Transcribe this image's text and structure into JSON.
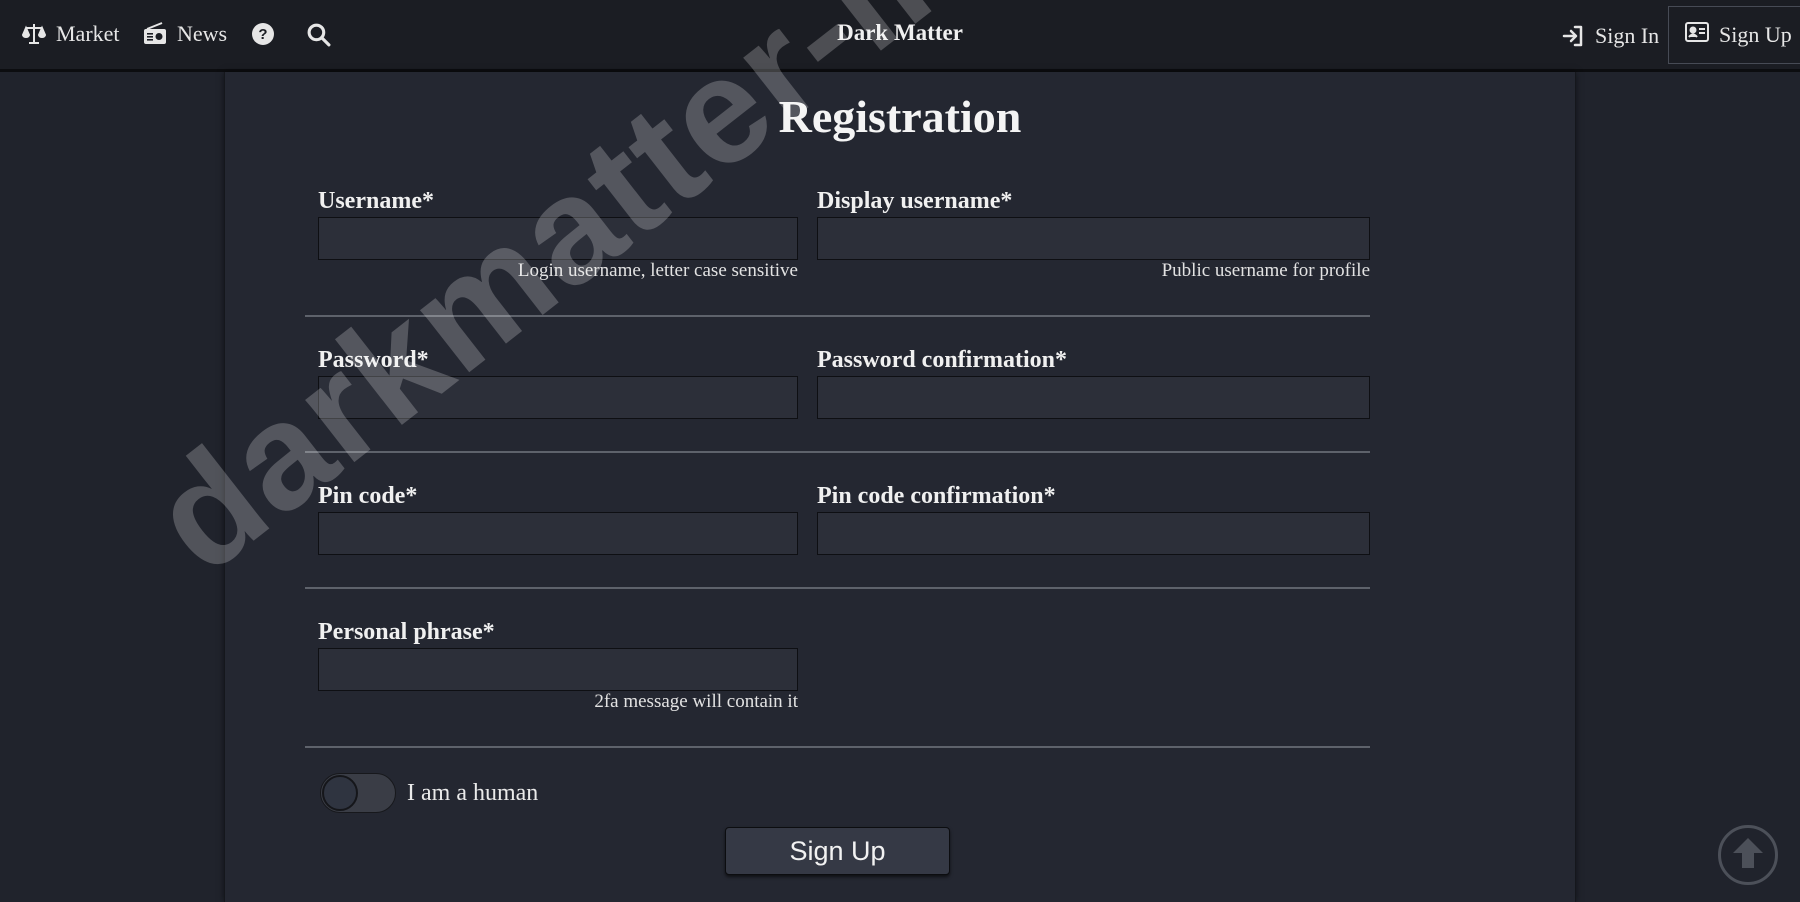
{
  "header": {
    "market_label": "Market",
    "news_label": "News",
    "site_title": "Dark Matter",
    "signin_label": "Sign In",
    "signup_label": "Sign Up"
  },
  "page": {
    "title": "Registration"
  },
  "form": {
    "username": {
      "label": "Username*",
      "value": "",
      "hint": "Login username, letter case sensitive"
    },
    "display_username": {
      "label": "Display username*",
      "value": "",
      "hint": "Public username for profile"
    },
    "password": {
      "label": "Password*",
      "value": ""
    },
    "password_confirmation": {
      "label": "Password confirmation*",
      "value": ""
    },
    "pin_code": {
      "label": "Pin code*",
      "value": ""
    },
    "pin_code_confirmation": {
      "label": "Pin code confirmation*",
      "value": ""
    },
    "personal_phrase": {
      "label": "Personal phrase*",
      "value": "",
      "hint": "2fa message will contain it"
    },
    "human_toggle": {
      "label": "I am a human",
      "checked": false
    },
    "submit_label": "Sign Up"
  },
  "watermark": {
    "text": "darkmatter-info.xyz"
  },
  "colors": {
    "background": "#20232c",
    "panel": "#242731",
    "topbar": "#1b1d23",
    "input": "#2c2f39",
    "text": "#e8e8e8"
  },
  "icons": {
    "market": "scale-balance-icon",
    "news": "radio-icon",
    "help": "question-circle-icon",
    "search": "search-icon",
    "signin": "sign-in-icon",
    "signup": "id-card-icon",
    "scroll_top": "arrow-up-circle-icon"
  }
}
